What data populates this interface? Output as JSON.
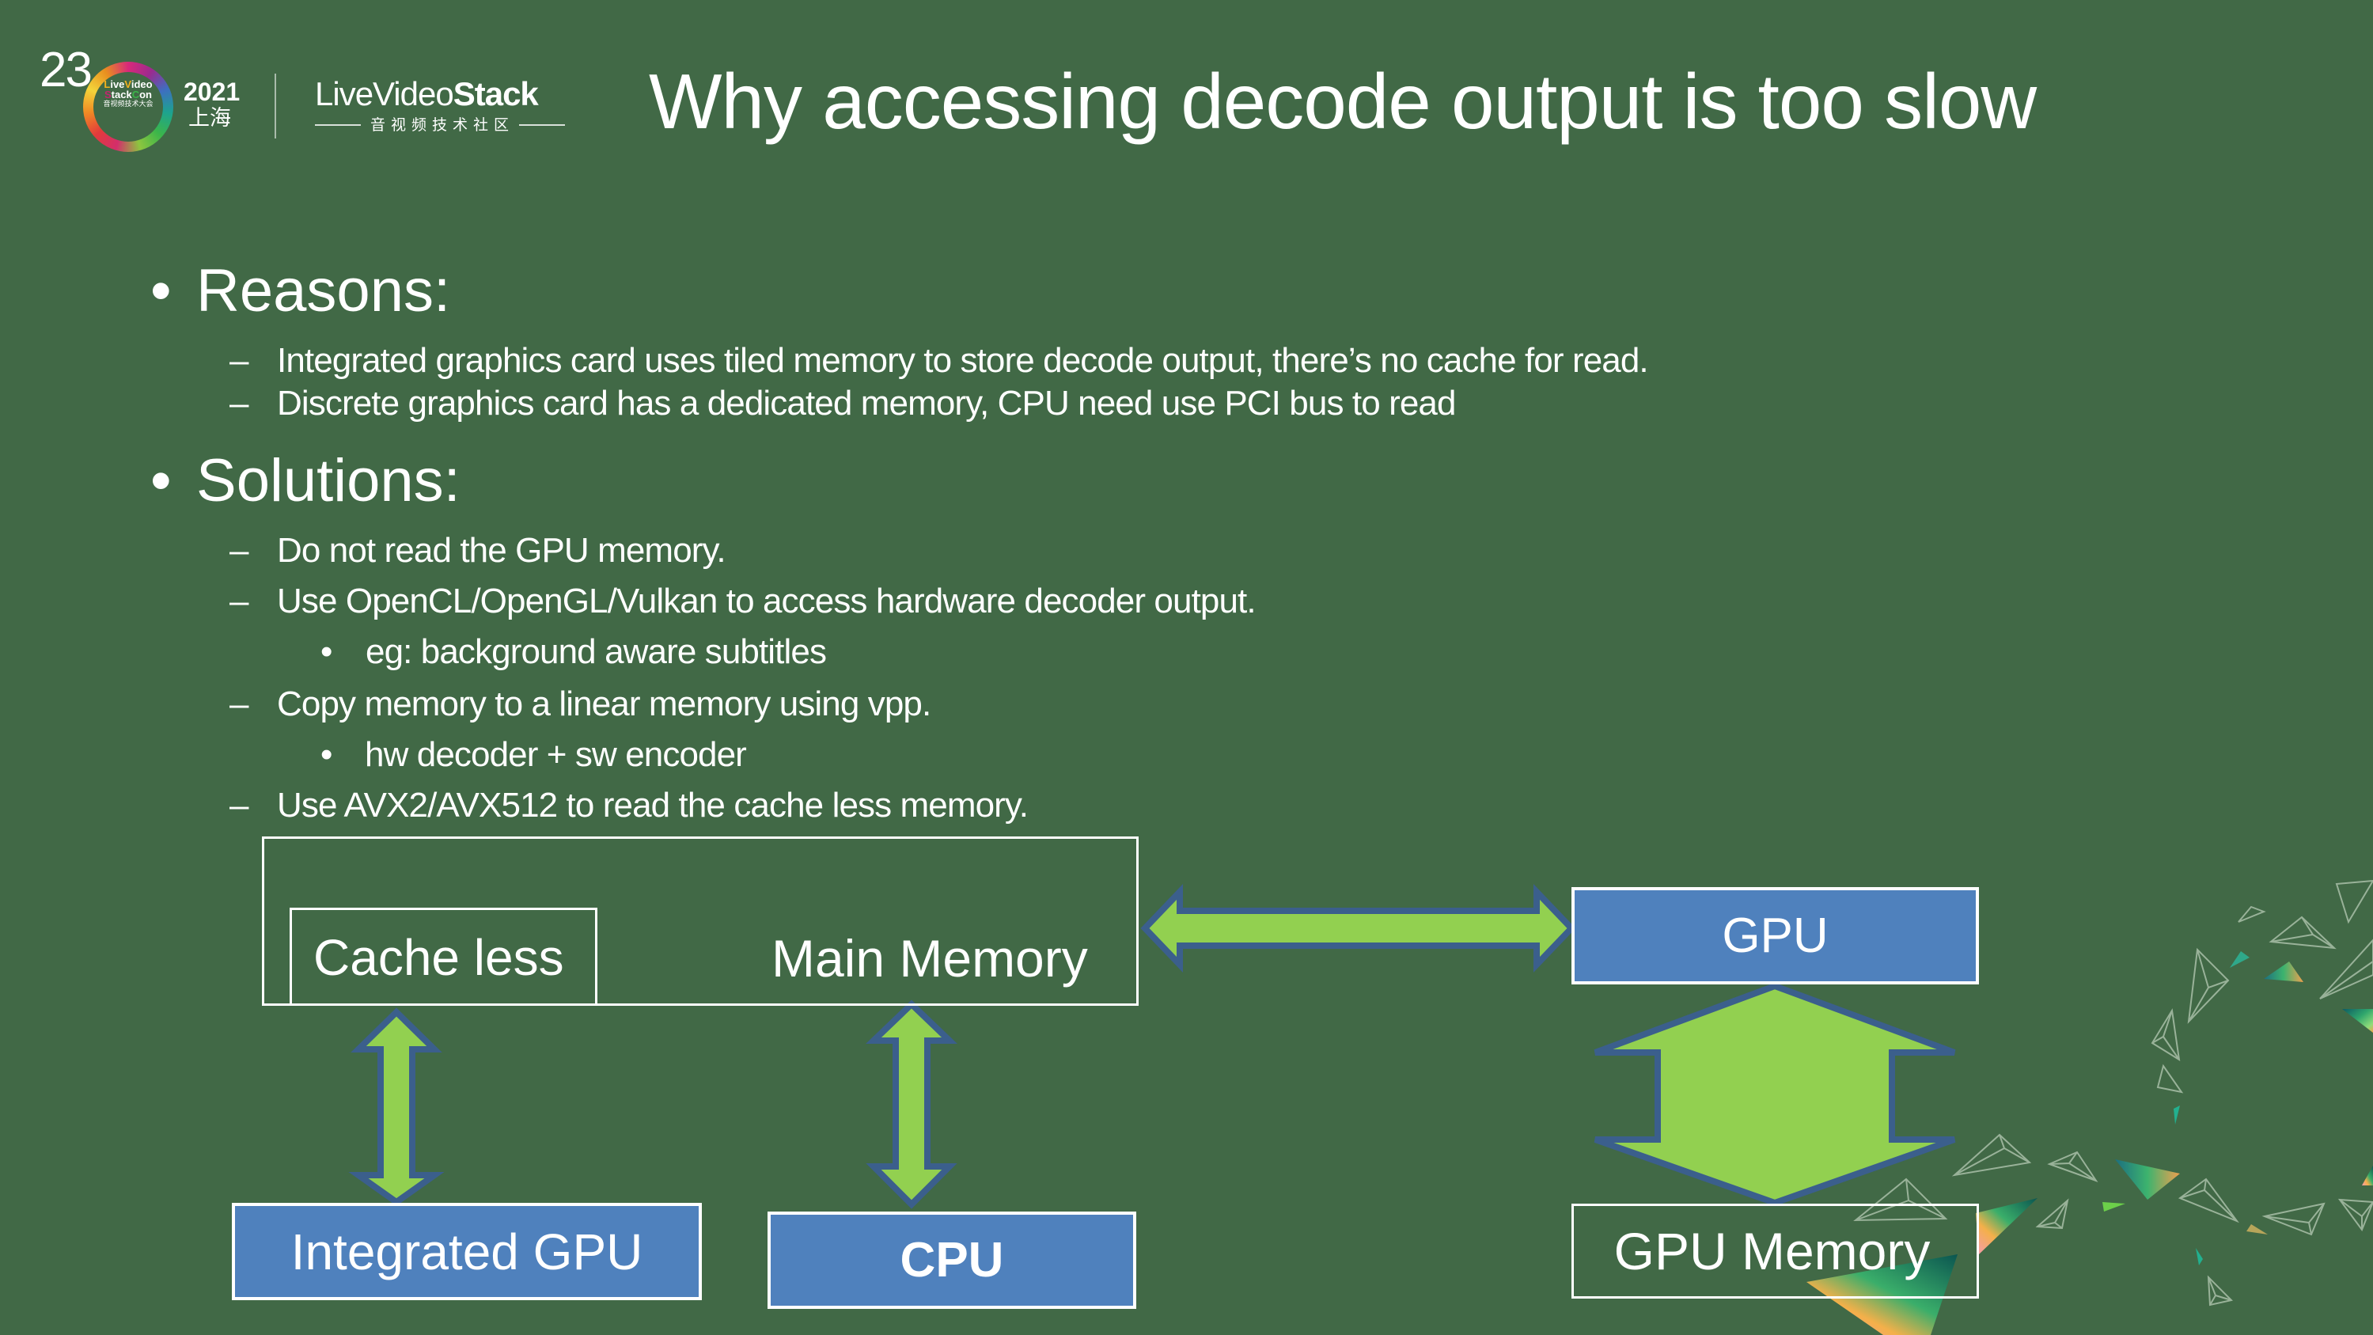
{
  "header": {
    "logo": {
      "edition_number": "23",
      "ring_line1_parts": [
        "L",
        "ive",
        "V",
        "ideo"
      ],
      "ring_line2_parts": [
        "S",
        "tack",
        "C",
        "on"
      ],
      "ring_line3": "音视频技术大会",
      "year": "2021",
      "city": "上海",
      "brand_thin": "LiveVideo",
      "brand_bold": "Stack",
      "brand_tagline": "音视频技术社区"
    },
    "title": "Why accessing decode output is too slow"
  },
  "content": {
    "sections": [
      {
        "heading": "Reasons:",
        "items": [
          {
            "level": 2,
            "marker": "–",
            "text": "Integrated graphics card uses tiled memory to store decode output, there’s no cache for read."
          },
          {
            "level": 2,
            "marker": "–",
            "text": "Discrete graphics card has a dedicated memory,  CPU need use PCI bus to read"
          }
        ]
      },
      {
        "heading": "Solutions:",
        "items": [
          {
            "level": 2,
            "marker": "–",
            "text": "Do not read the GPU memory."
          },
          {
            "level": 2,
            "marker": "–",
            "text": "Use OpenCL/OpenGL/Vulkan to access hardware decoder output."
          },
          {
            "level": 3,
            "marker": "•",
            "text": " eg: background aware subtitles"
          },
          {
            "level": 2,
            "marker": "–",
            "text": "Copy memory to a linear memory using vpp."
          },
          {
            "level": 3,
            "marker": "•",
            "text": "hw decoder + sw encoder"
          },
          {
            "level": 2,
            "marker": "–",
            "text": "Use AVX2/AVX512 to read the cache less memory."
          }
        ]
      }
    ],
    "bullet_marker": "•"
  },
  "diagram": {
    "nodes": {
      "main_memory": "Main Memory",
      "cache_less": "Cache less",
      "gpu": "GPU",
      "gpu_memory": "GPU Memory",
      "integrated_gpu": "Integrated GPU",
      "cpu": "CPU"
    },
    "edges": [
      {
        "from": "main_memory",
        "to": "gpu",
        "direction": "bidirectional"
      },
      {
        "from": "gpu",
        "to": "gpu_memory",
        "direction": "bidirectional"
      },
      {
        "from": "cache_less",
        "to": "integrated_gpu",
        "direction": "bidirectional"
      },
      {
        "from": "main_memory",
        "to": "cpu",
        "direction": "bidirectional"
      }
    ],
    "colors": {
      "background": "#416946",
      "node_fill": "#4f81bd",
      "node_border": "#ffffff",
      "arrow_fill": "#92d050",
      "arrow_stroke": "#3b5f8c"
    }
  }
}
